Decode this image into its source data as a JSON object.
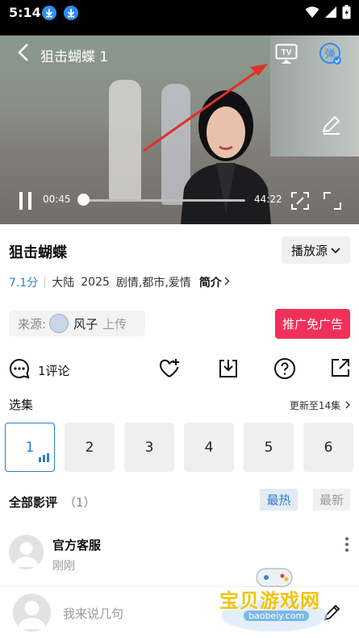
{
  "status_bar": {
    "time": "5:14"
  },
  "player": {
    "title": "狙击蝴蝶 1",
    "current_time": "00:45",
    "duration": "44:22",
    "progress": 0.017,
    "cast_label": "TV",
    "danmaku_label": "弹"
  },
  "show": {
    "title": "狙击蝴蝶",
    "source_button": "播放源",
    "score": "7.1分",
    "region": "大陆",
    "year": "2025",
    "genres": "剧情,都市,爱情",
    "intro_link": "简介",
    "source_label": "来源:",
    "uploader_name": "风子",
    "uploader_action": "上传",
    "promo_button": "推广免广告"
  },
  "actions": {
    "comment_count": "1评论"
  },
  "episodes": {
    "heading": "选集",
    "update_info": "更新至14集",
    "items": [
      "1",
      "2",
      "3",
      "4",
      "5",
      "6"
    ],
    "active_index": 0
  },
  "reviews": {
    "heading": "全部影评",
    "count": "（1）",
    "sort_hot": "最热",
    "sort_new": "最新",
    "items": [
      {
        "user": "官方客服",
        "time": "刚刚"
      }
    ]
  },
  "comment_input": {
    "placeholder": "我来说几句"
  },
  "watermark": {
    "text": "宝贝游戏网",
    "url": "baobeiy.com"
  },
  "colors": {
    "accent": "#2a7fd1",
    "promo": "#f0305a",
    "annotation_arrow": "#e0302a"
  }
}
